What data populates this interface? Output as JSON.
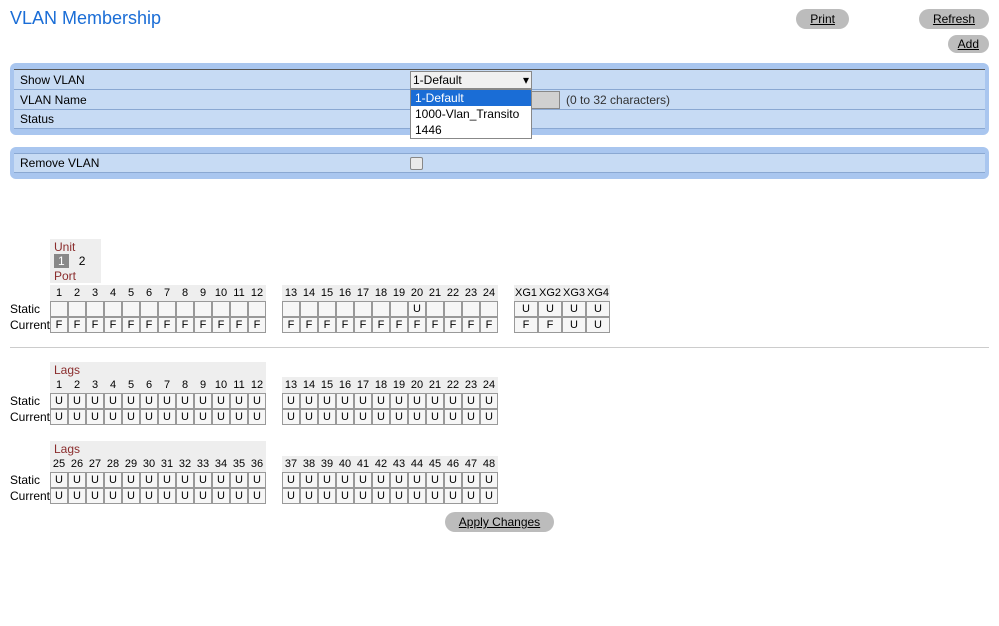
{
  "title": "VLAN Membership",
  "buttons": {
    "print": "Print",
    "refresh": "Refresh",
    "add": "Add",
    "apply": "Apply Changes"
  },
  "form": {
    "showVlanLabel": "Show VLAN",
    "showVlanValue": "1-Default",
    "options": [
      "1-Default",
      "1000-Vlan_Transito",
      "1446"
    ],
    "nameLabel": "VLAN Name",
    "nameValue": "",
    "nameHint": "(0 to 32 characters)",
    "statusLabel": "Status",
    "statusValue": "",
    "removeLabel": "Remove VLAN"
  },
  "unit": {
    "label": "Unit",
    "selected": "1",
    "other": "2",
    "portLabel": "Port"
  },
  "rowLabels": {
    "static": "Static",
    "current": "Current",
    "lags": "Lags"
  },
  "ports": {
    "heads1": [
      "1",
      "2",
      "3",
      "4",
      "5",
      "6",
      "7",
      "8",
      "9",
      "10",
      "11",
      "12"
    ],
    "heads2": [
      "13",
      "14",
      "15",
      "16",
      "17",
      "18",
      "19",
      "20",
      "21",
      "22",
      "23",
      "24"
    ],
    "xgHeads": [
      "XG1",
      "XG2",
      "XG3",
      "XG4"
    ],
    "static1": [
      "",
      "",
      "",
      "",
      "",
      "",
      "",
      "",
      "",
      "",
      "",
      ""
    ],
    "static2": [
      "",
      "",
      "",
      "",
      "",
      "",
      "",
      "U",
      "",
      "",
      "",
      ""
    ],
    "staticXG": [
      "U",
      "U",
      "U",
      "U"
    ],
    "current1": [
      "F",
      "F",
      "F",
      "F",
      "F",
      "F",
      "F",
      "F",
      "F",
      "F",
      "F",
      "F"
    ],
    "current2": [
      "F",
      "F",
      "F",
      "F",
      "F",
      "F",
      "F",
      "F",
      "F",
      "F",
      "F",
      "F"
    ],
    "currentXG": [
      "F",
      "F",
      "U",
      "U"
    ]
  },
  "lagsA": {
    "heads1": [
      "1",
      "2",
      "3",
      "4",
      "5",
      "6",
      "7",
      "8",
      "9",
      "10",
      "11",
      "12"
    ],
    "heads2": [
      "13",
      "14",
      "15",
      "16",
      "17",
      "18",
      "19",
      "20",
      "21",
      "22",
      "23",
      "24"
    ],
    "static1": [
      "U",
      "U",
      "U",
      "U",
      "U",
      "U",
      "U",
      "U",
      "U",
      "U",
      "U",
      "U"
    ],
    "static2": [
      "U",
      "U",
      "U",
      "U",
      "U",
      "U",
      "U",
      "U",
      "U",
      "U",
      "U",
      "U"
    ],
    "current1": [
      "U",
      "U",
      "U",
      "U",
      "U",
      "U",
      "U",
      "U",
      "U",
      "U",
      "U",
      "U"
    ],
    "current2": [
      "U",
      "U",
      "U",
      "U",
      "U",
      "U",
      "U",
      "U",
      "U",
      "U",
      "U",
      "U"
    ]
  },
  "lagsB": {
    "heads1": [
      "25",
      "26",
      "27",
      "28",
      "29",
      "30",
      "31",
      "32",
      "33",
      "34",
      "35",
      "36"
    ],
    "heads2": [
      "37",
      "38",
      "39",
      "40",
      "41",
      "42",
      "43",
      "44",
      "45",
      "46",
      "47",
      "48"
    ],
    "static1": [
      "U",
      "U",
      "U",
      "U",
      "U",
      "U",
      "U",
      "U",
      "U",
      "U",
      "U",
      "U"
    ],
    "static2": [
      "U",
      "U",
      "U",
      "U",
      "U",
      "U",
      "U",
      "U",
      "U",
      "U",
      "U",
      "U"
    ],
    "current1": [
      "U",
      "U",
      "U",
      "U",
      "U",
      "U",
      "U",
      "U",
      "U",
      "U",
      "U",
      "U"
    ],
    "current2": [
      "U",
      "U",
      "U",
      "U",
      "U",
      "U",
      "U",
      "U",
      "U",
      "U",
      "U",
      "U"
    ]
  }
}
